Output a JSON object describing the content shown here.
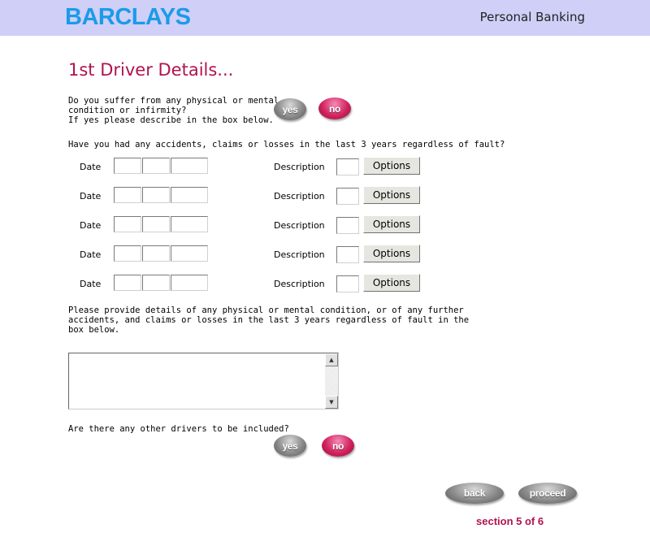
{
  "header": {
    "logo": "BARCLAYS",
    "right_title": "Personal Banking"
  },
  "page_title": "1st Driver Details...",
  "q1": {
    "line1": "Do you suffer from any physical or mental",
    "line2": "condition or infirmity?",
    "line3": "If yes please describe in the box below.",
    "yes": "yes",
    "no": "no"
  },
  "q2": "Have you had any accidents, claims or losses in the last 3 years regardless of fault?",
  "rows": [
    {
      "date_label": "Date",
      "desc_label": "Description",
      "options": "Options",
      "day": "",
      "month": "",
      "year": "",
      "code": ""
    },
    {
      "date_label": "Date",
      "desc_label": "Description",
      "options": "Options",
      "day": "",
      "month": "",
      "year": "",
      "code": ""
    },
    {
      "date_label": "Date",
      "desc_label": "Description",
      "options": "Options",
      "day": "",
      "month": "",
      "year": "",
      "code": ""
    },
    {
      "date_label": "Date",
      "desc_label": "Description",
      "options": "Options",
      "day": "",
      "month": "",
      "year": "",
      "code": ""
    },
    {
      "date_label": "Date",
      "desc_label": "Description",
      "options": "Options",
      "day": "",
      "month": "",
      "year": "",
      "code": ""
    }
  ],
  "details_prompt": {
    "line1": "Please provide details of any physical or mental condition, or of any further",
    "line2": "accidents, and claims or losses in the last 3 years regardless of fault in the",
    "line3": "box below."
  },
  "details_value": "",
  "q3": {
    "text": "Are there any other drivers to be included?",
    "yes": "yes",
    "no": "no"
  },
  "nav": {
    "back": "back",
    "proceed": "proceed",
    "section": "section 5 of 6"
  },
  "colors": {
    "header_bg": "#cfcff7",
    "logo": "#1b9be8",
    "accent": "#b0134f"
  }
}
